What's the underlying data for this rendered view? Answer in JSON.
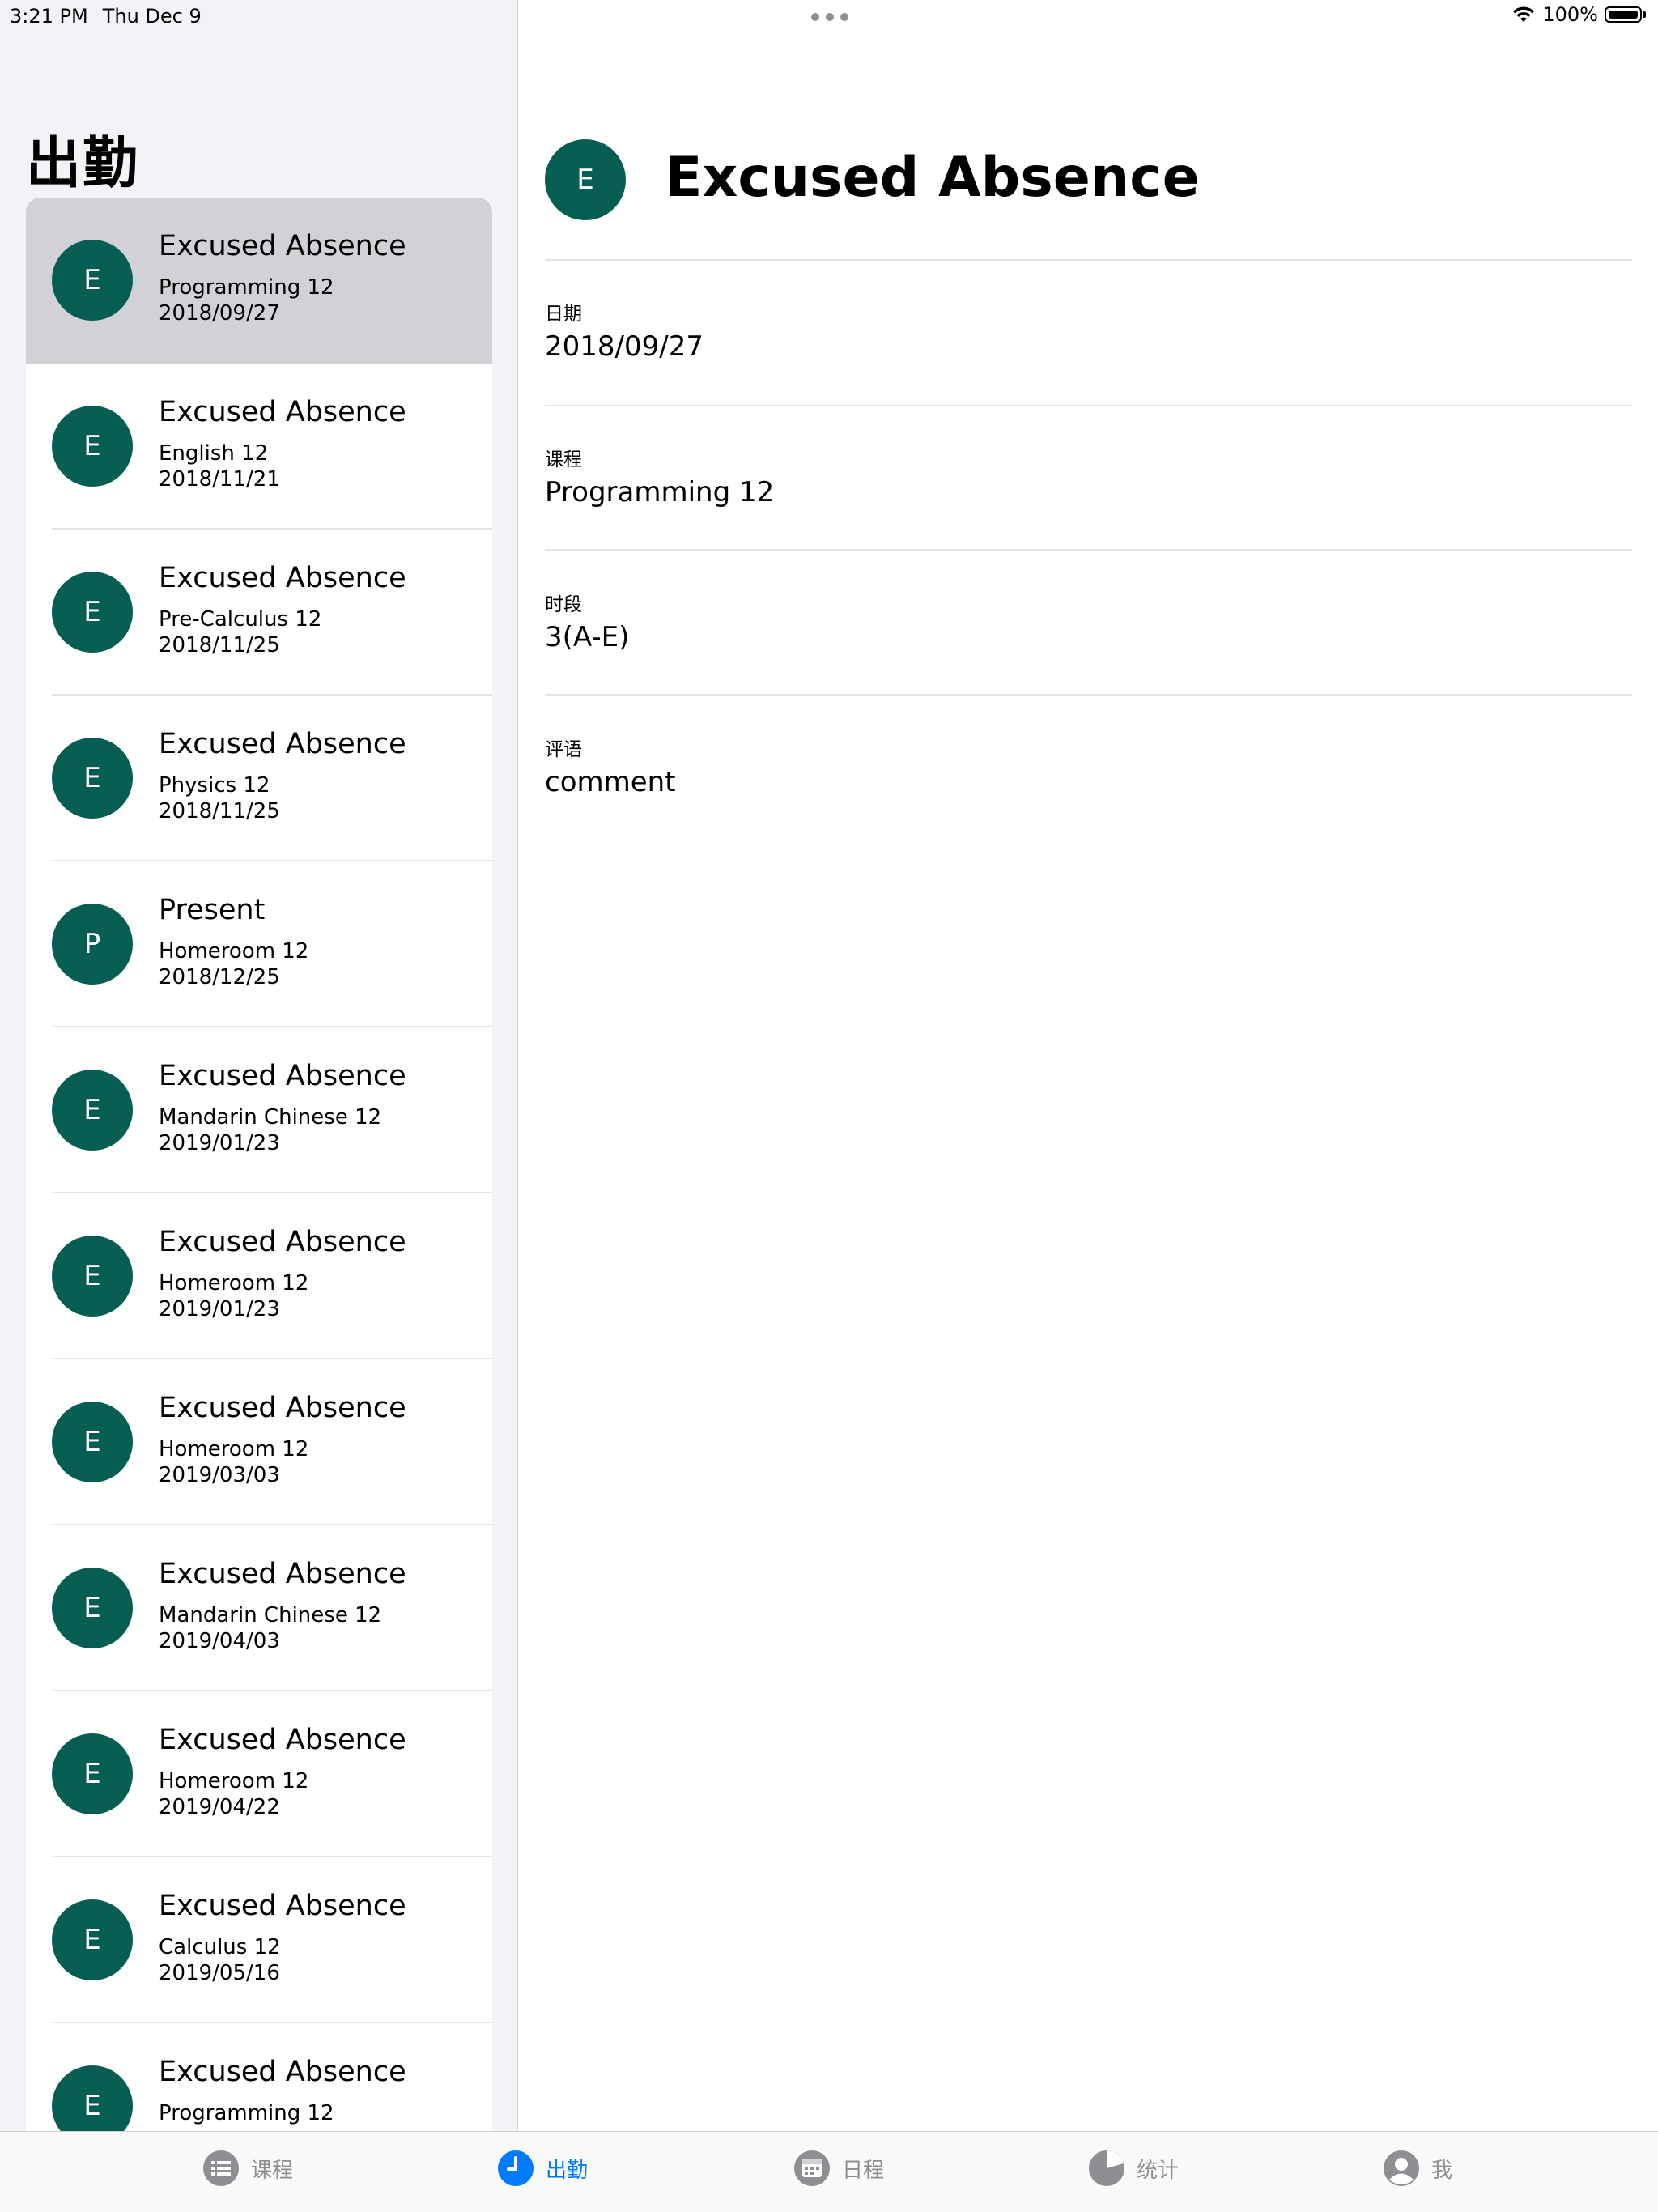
{
  "status_bar": {
    "time": "3:21 PM",
    "date": "Thu Dec 9",
    "battery": "100%"
  },
  "sidebar": {
    "title": "出勤",
    "items": [
      {
        "initial": "E",
        "title": "Excused Absence",
        "course": "Programming 12",
        "date": "2018/09/27",
        "selected": true
      },
      {
        "initial": "E",
        "title": "Excused Absence",
        "course": "English 12",
        "date": "2018/11/21"
      },
      {
        "initial": "E",
        "title": "Excused Absence",
        "course": "Pre-Calculus 12",
        "date": "2018/11/25"
      },
      {
        "initial": "E",
        "title": "Excused Absence",
        "course": "Physics 12",
        "date": "2018/11/25"
      },
      {
        "initial": "P",
        "title": "Present",
        "course": "Homeroom 12",
        "date": "2018/12/25"
      },
      {
        "initial": "E",
        "title": "Excused Absence",
        "course": "Mandarin Chinese 12",
        "date": "2019/01/23"
      },
      {
        "initial": "E",
        "title": "Excused Absence",
        "course": "Homeroom 12",
        "date": "2019/01/23"
      },
      {
        "initial": "E",
        "title": "Excused Absence",
        "course": "Homeroom 12",
        "date": "2019/03/03"
      },
      {
        "initial": "E",
        "title": "Excused Absence",
        "course": "Mandarin Chinese 12",
        "date": "2019/04/03"
      },
      {
        "initial": "E",
        "title": "Excused Absence",
        "course": "Homeroom 12",
        "date": "2019/04/22"
      },
      {
        "initial": "E",
        "title": "Excused Absence",
        "course": "Calculus 12",
        "date": "2019/05/16"
      },
      {
        "initial": "E",
        "title": "Excused Absence",
        "course": "Programming 12",
        "date": ""
      }
    ]
  },
  "detail": {
    "initial": "E",
    "title": "Excused Absence",
    "fields": [
      {
        "label": "日期",
        "value": "2018/09/27"
      },
      {
        "label": "课程",
        "value": "Programming 12"
      },
      {
        "label": "时段",
        "value": "3(A-E)"
      },
      {
        "label": "评语",
        "value": "comment"
      }
    ]
  },
  "tabbar": {
    "tabs": [
      {
        "label": "课程",
        "icon": "list-icon"
      },
      {
        "label": "出勤",
        "icon": "clock-icon",
        "active": true
      },
      {
        "label": "日程",
        "icon": "calendar-icon"
      },
      {
        "label": "统计",
        "icon": "pie-chart-icon"
      },
      {
        "label": "我",
        "icon": "person-icon"
      }
    ]
  },
  "colors": {
    "avatar": "#065e53",
    "accent": "#007aff",
    "inactive_tab": "#8e8e93",
    "selected_row": "#d1d1d6"
  }
}
